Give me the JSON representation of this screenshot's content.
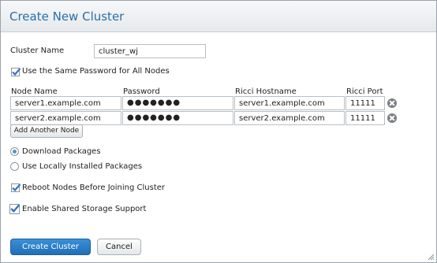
{
  "dialog": {
    "title": "Create New Cluster"
  },
  "cluster_name": {
    "label": "Cluster Name",
    "value": "cluster_wj"
  },
  "same_password": {
    "label": "Use the Same Password for All Nodes",
    "checked": true
  },
  "nodes_table": {
    "headers": {
      "node_name": "Node Name",
      "password": "Password",
      "ricci_hostname": "Ricci Hostname",
      "ricci_port": "Ricci Port"
    },
    "rows": [
      {
        "node_name": "server1.example.com",
        "password": "●●●●●●●",
        "ricci_hostname": "server1.example.com",
        "ricci_port": "11111"
      },
      {
        "node_name": "server2.example.com",
        "password": "●●●●●●●",
        "ricci_hostname": "server2.example.com",
        "ricci_port": "11111"
      }
    ],
    "add_button": "Add Another Node"
  },
  "packages": {
    "download": {
      "label": "Download Packages",
      "selected": true
    },
    "local": {
      "label": "Use Locally Installed Packages",
      "selected": false
    }
  },
  "reboot": {
    "label": "Reboot Nodes Before Joining Cluster",
    "checked": true
  },
  "shared_storage": {
    "label": "Enable Shared Storage Support",
    "checked": true
  },
  "actions": {
    "create": "Create Cluster",
    "cancel": "Cancel"
  },
  "colors": {
    "accent": "#2a6fa8",
    "primary_button": "#2a7cc7",
    "check": "#3b73b8"
  }
}
